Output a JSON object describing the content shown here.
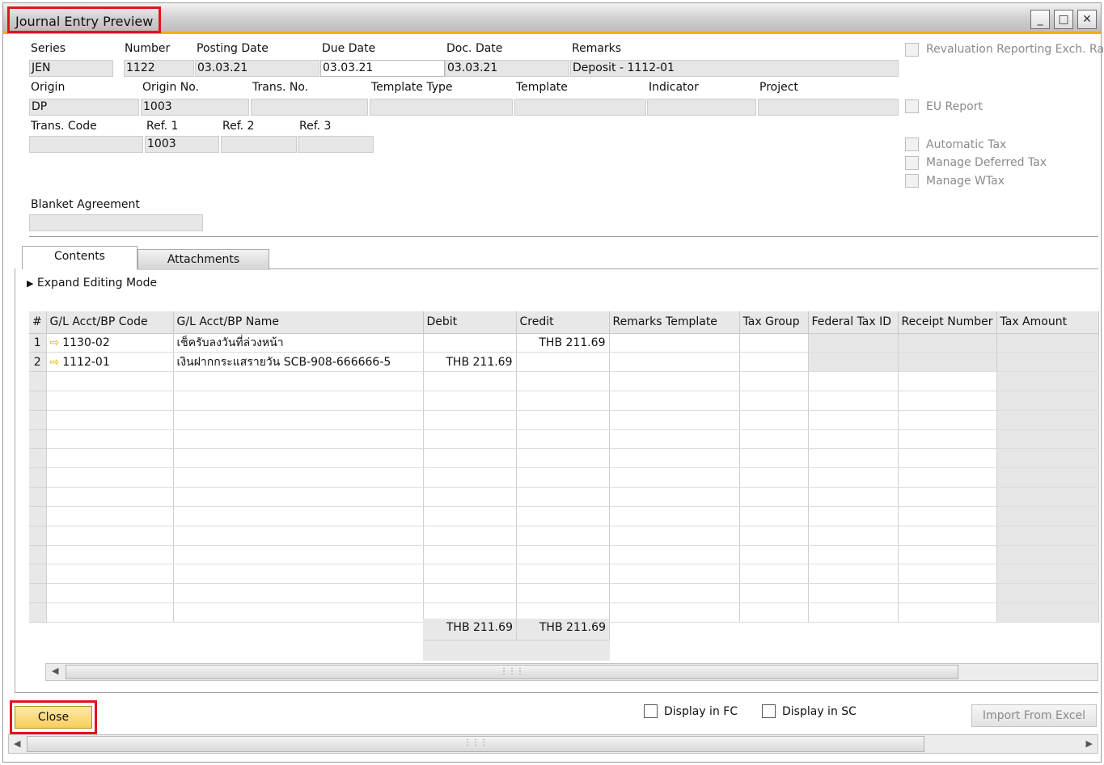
{
  "window": {
    "title": "Journal Entry Preview",
    "controls": {
      "minimize": "_",
      "maximize": "□",
      "close": "✕"
    }
  },
  "header": {
    "series": {
      "label": "Series",
      "value": "JEN"
    },
    "number": {
      "label": "Number",
      "value": "1122"
    },
    "posting_date": {
      "label": "Posting Date",
      "value": "03.03.21"
    },
    "due_date": {
      "label": "Due Date",
      "value": "03.03.21"
    },
    "doc_date": {
      "label": "Doc. Date",
      "value": "03.03.21"
    },
    "remarks": {
      "label": "Remarks",
      "value": "Deposit - 1112-01"
    },
    "origin": {
      "label": "Origin",
      "value": "DP"
    },
    "origin_no": {
      "label": "Origin No.",
      "value": "1003"
    },
    "trans_no": {
      "label": "Trans. No.",
      "value": ""
    },
    "template_type": {
      "label": "Template Type",
      "value": ""
    },
    "template": {
      "label": "Template",
      "value": ""
    },
    "indicator": {
      "label": "Indicator",
      "value": ""
    },
    "project": {
      "label": "Project",
      "value": ""
    },
    "trans_code": {
      "label": "Trans. Code",
      "value": ""
    },
    "ref1": {
      "label": "Ref. 1",
      "value": "1003"
    },
    "ref2": {
      "label": "Ref. 2",
      "value": ""
    },
    "ref3": {
      "label": "Ref. 3",
      "value": ""
    },
    "blanket_agreement": {
      "label": "Blanket Agreement",
      "value": ""
    }
  },
  "options": {
    "revaluation": "Revaluation Reporting Exch. Rat",
    "eu_report": "EU Report",
    "automatic_tax": "Automatic Tax",
    "manage_deferred_tax": "Manage Deferred Tax",
    "manage_wtax": "Manage WTax"
  },
  "tabs": {
    "contents": "Contents",
    "attachments": "Attachments"
  },
  "expand_editing_mode": "Expand Editing Mode",
  "table": {
    "columns": [
      "#",
      "G/L Acct/BP Code",
      "G/L Acct/BP Name",
      "Debit",
      "Credit",
      "Remarks Template",
      "Tax Group",
      "Federal Tax ID",
      "Receipt Number",
      "Tax Amount"
    ],
    "rows": [
      {
        "num": "1",
        "code": "1130-02",
        "name": "เช็ครับลงวันที่ล่วงหน้า",
        "debit": "",
        "credit": "THB 211.69"
      },
      {
        "num": "2",
        "code": "1112-01",
        "name": "เงินฝากกระแสรายวัน SCB-908-666666-5",
        "debit": "THB 211.69",
        "credit": ""
      }
    ],
    "totals": {
      "debit": "THB 211.69",
      "credit": "THB 211.69"
    }
  },
  "footer": {
    "close": "Close",
    "display_fc": "Display in FC",
    "display_sc": "Display in SC",
    "import_excel": "Import From Excel"
  }
}
